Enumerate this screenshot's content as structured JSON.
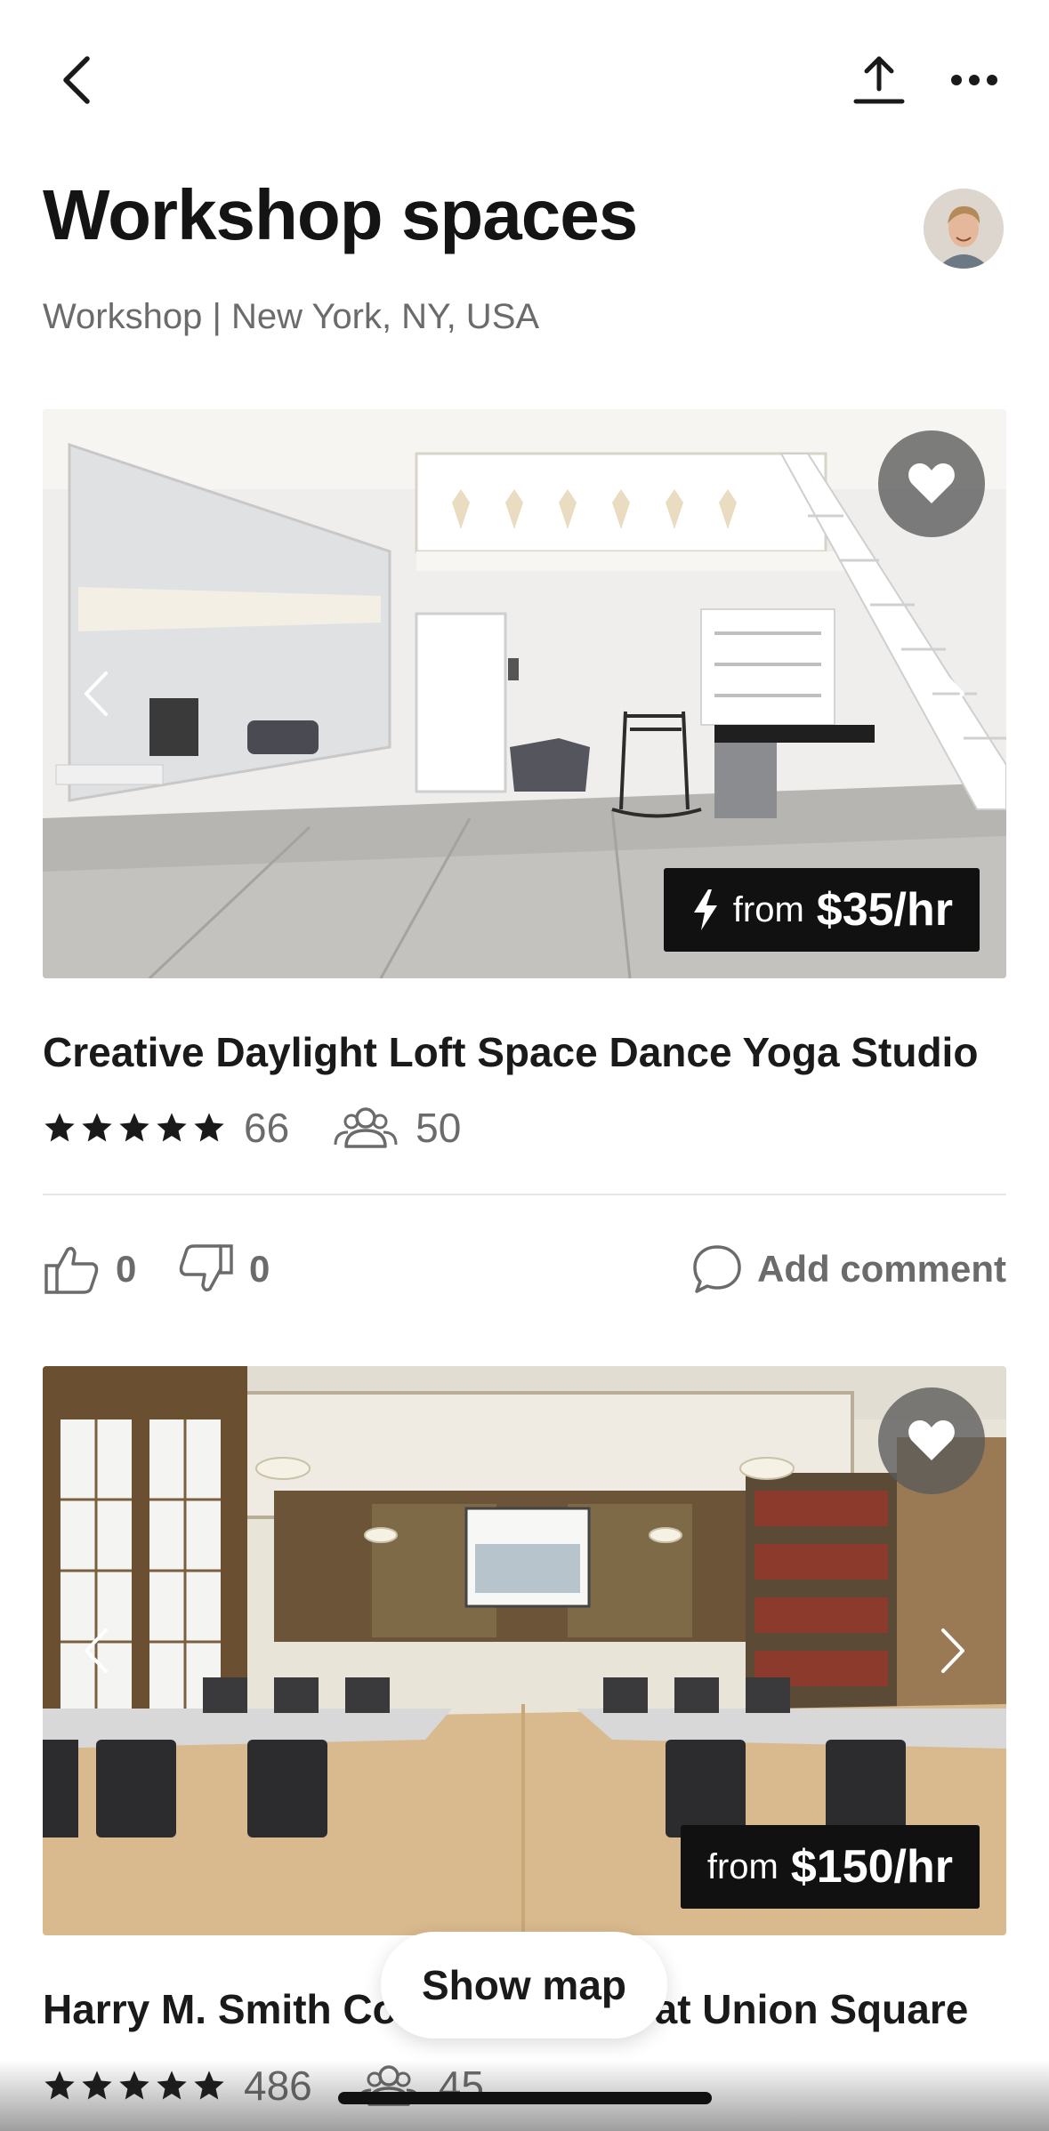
{
  "header": {
    "title": "Workshop spaces",
    "subtitle": "Workshop | New York, NY, USA"
  },
  "icons": {
    "back": "chevron-left-icon",
    "share": "share-upload-icon",
    "more": "more-horizontal-icon",
    "favorite": "heart-icon",
    "instant_book": "lightning-bolt-icon",
    "star": "star-icon",
    "capacity": "people-icon",
    "like": "thumbs-up-icon",
    "dislike": "thumbs-down-icon",
    "comment": "speech-bubble-icon"
  },
  "listings": [
    {
      "price_from": "from",
      "price": "$35/hr",
      "instant_book": true,
      "title": "Creative Daylight Loft Space Dance Yoga Studio",
      "rating_stars": 5,
      "reviews": "66",
      "capacity": "50",
      "likes": "0",
      "dislikes": "0",
      "comment_label": "Add comment"
    },
    {
      "price_from": "from",
      "price": "$150/hr",
      "instant_book": false,
      "title": "Harry M. Smith Co",
      "title_end": "n at Union Square",
      "rating_stars": 5,
      "reviews": "486",
      "capacity": "45"
    }
  ],
  "map_button": {
    "label": "Show map"
  },
  "colors": {
    "text_primary": "#1a1a1a",
    "text_secondary": "#6b6b6b",
    "badge_bg": "#111111",
    "favorite_bg": "#5a5a5a",
    "divider": "#e6e6e6"
  }
}
